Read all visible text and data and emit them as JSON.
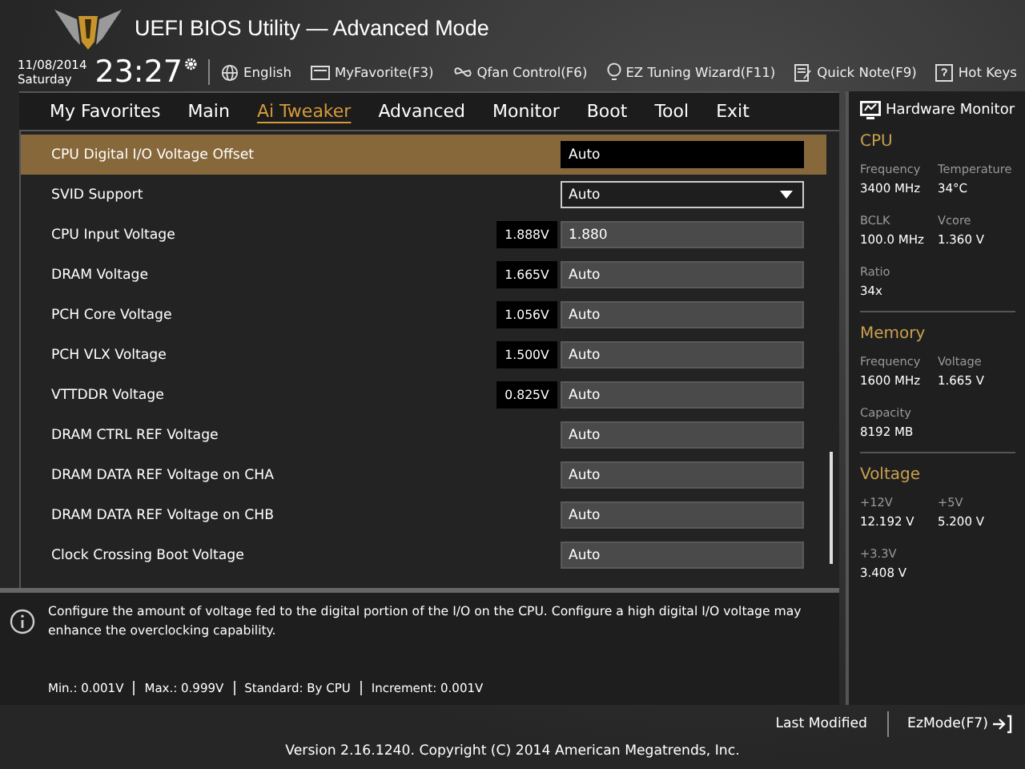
{
  "window": {
    "title": "UEFI BIOS Utility — Advanced Mode"
  },
  "clock": {
    "date": "11/08/2014",
    "day": "Saturday",
    "time": "23:27"
  },
  "toolbar": [
    "English",
    "MyFavorite(F3)",
    "Qfan Control(F6)",
    "EZ Tuning Wizard(F11)",
    "Quick Note(F9)",
    "Hot Keys"
  ],
  "tabs": [
    {
      "label": "My Favorites",
      "selected": false
    },
    {
      "label": "Main",
      "selected": false
    },
    {
      "label": "Ai Tweaker",
      "selected": true
    },
    {
      "label": "Advanced",
      "selected": false
    },
    {
      "label": "Monitor",
      "selected": false
    },
    {
      "label": "Boot",
      "selected": false
    },
    {
      "label": "Tool",
      "selected": false
    },
    {
      "label": "Exit",
      "selected": false
    }
  ],
  "settings": [
    {
      "kind": "field",
      "label": "CPU Digital I/O Voltage Offset",
      "value": "Auto",
      "selected": true
    },
    {
      "kind": "dropdown",
      "label": "SVID Support",
      "value": "Auto",
      "selected": false
    },
    {
      "kind": "field",
      "label": "CPU Input Voltage",
      "reading": "1.888V",
      "value": "1.880",
      "selected": false
    },
    {
      "kind": "field",
      "label": "DRAM Voltage",
      "reading": "1.665V",
      "value": "Auto",
      "selected": false
    },
    {
      "kind": "field",
      "label": "PCH Core Voltage",
      "reading": "1.056V",
      "value": "Auto",
      "selected": false
    },
    {
      "kind": "field",
      "label": "PCH VLX Voltage",
      "reading": "1.500V",
      "value": "Auto",
      "selected": false
    },
    {
      "kind": "field",
      "label": "VTTDDR Voltage",
      "reading": "0.825V",
      "value": "Auto",
      "selected": false
    },
    {
      "kind": "field",
      "label": "DRAM CTRL REF Voltage",
      "value": "Auto",
      "selected": false
    },
    {
      "kind": "field",
      "label": "DRAM DATA REF Voltage on CHA",
      "value": "Auto",
      "selected": false
    },
    {
      "kind": "field",
      "label": "DRAM DATA REF Voltage on CHB",
      "value": "Auto",
      "selected": false
    },
    {
      "kind": "field",
      "label": "Clock Crossing Boot Voltage",
      "value": "Auto",
      "selected": false
    }
  ],
  "help": {
    "text": "Configure the amount of voltage fed to the digital portion of the I/O on the CPU. Configure a high digital I/O voltage may enhance the overclocking capability.",
    "specs": [
      "Min.: 0.001V",
      "Max.: 0.999V",
      "Standard: By CPU",
      "Increment: 0.001V"
    ]
  },
  "hardware_monitor": {
    "title": "Hardware Monitor",
    "sections": [
      {
        "title": "CPU",
        "items": [
          {
            "label": "Frequency",
            "value": "3400 MHz"
          },
          {
            "label": "Temperature",
            "value": "34°C"
          },
          {
            "label": "BCLK",
            "value": "100.0 MHz"
          },
          {
            "label": "Vcore",
            "value": "1.360 V"
          },
          {
            "label": "Ratio",
            "value": "34x"
          }
        ]
      },
      {
        "title": "Memory",
        "items": [
          {
            "label": "Frequency",
            "value": "1600 MHz"
          },
          {
            "label": "Voltage",
            "value": "1.665 V"
          },
          {
            "label": "Capacity",
            "value": "8192 MB"
          }
        ]
      },
      {
        "title": "Voltage",
        "items": [
          {
            "label": "+12V",
            "value": "12.192 V"
          },
          {
            "label": "+5V",
            "value": "5.200 V"
          },
          {
            "label": "+3.3V",
            "value": "3.408 V"
          }
        ]
      }
    ]
  },
  "footer": {
    "buttons": [
      "Last Modified",
      "EzMode(F7)"
    ],
    "copyright": "Version 2.16.1240. Copyright (C) 2014 American Megatrends, Inc."
  }
}
